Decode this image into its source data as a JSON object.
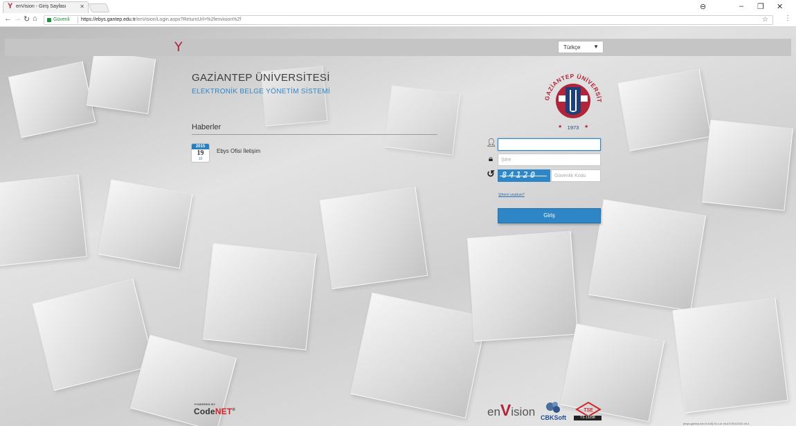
{
  "browser": {
    "tab_title": "enVision - Giriş Sayfası",
    "secure_label": "Güvenli",
    "url_host": "https://ebys.gantep.edu.tr",
    "url_path": "/enVision/Login.aspx?ReturnUrl=%2fenvision%2f"
  },
  "header": {
    "language": "Türkçe"
  },
  "university": {
    "name": "GAZİANTEP ÜNİVERSİTESİ",
    "subtitle": "ELEKTRONİK BELGE YÖNETİM SİSTEMİ",
    "logo_ring_text": "GAZİANTEP ÜNİVERSİTESİ",
    "logo_year": "1973"
  },
  "news": {
    "heading": "Haberler",
    "items": [
      {
        "year": "2015",
        "day": "19",
        "month": "10",
        "title": "Ebys Ofisi İletişim"
      }
    ]
  },
  "login": {
    "username_value": "",
    "password_placeholder": "Şifre",
    "captcha_text": "84120",
    "security_code_placeholder": "Güvenlik Kodu",
    "forgot_password": "Şifremi unuttum?",
    "login_button": "Giriş"
  },
  "footer": {
    "powered_by": "POWERED BY",
    "codenet_a": "Code",
    "codenet_b": "NET",
    "envision_a": "en",
    "envision_v": "V",
    "envision_b": "ision",
    "cbk": "CBKSoft",
    "tse_number": "TS 13298",
    "version": "[ebys.gantep.edu.tr:443] Sv-Lck v8.d1709.b2022.d0.d"
  },
  "colors": {
    "brand_red": "#b0253a",
    "accent_blue": "#2f86c7"
  }
}
